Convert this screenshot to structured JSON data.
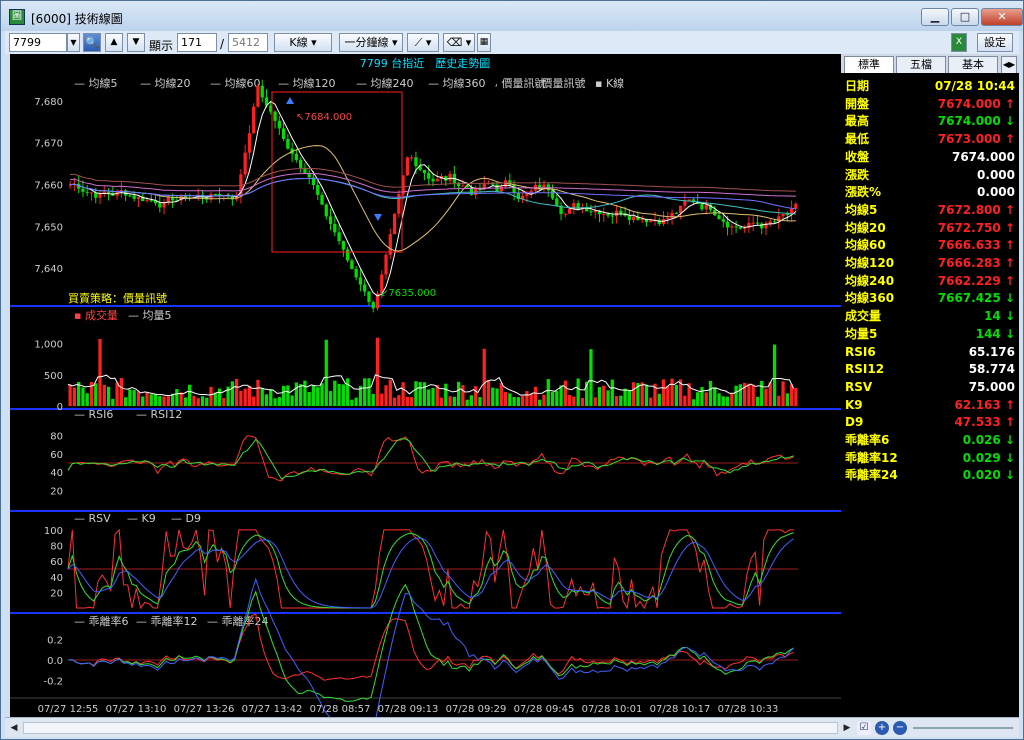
{
  "window": {
    "title": "[6000] 技術線圖",
    "app_icon": "chart-app-icon"
  },
  "toolbar": {
    "symbol": "7799",
    "display_label": "顯示",
    "display_count": "171",
    "separator": "/",
    "total_count": "5412",
    "kline_label": "K線",
    "period_label": "一分鐘線",
    "settings_label": "設定"
  },
  "chart": {
    "header": "7799 台指近　歷史走勢圖",
    "legend_main": [
      "均線5",
      "均線20",
      "均線60",
      "均線120",
      "均線240",
      "均線360",
      "價量訊號",
      "價量訊號",
      "K線"
    ],
    "high_marker": "7684.000",
    "low_marker": "7635.000",
    "strategy_label": "買賣策略：價量訊號",
    "price_ticks": [
      "7,680",
      "7,670",
      "7,660",
      "7,650",
      "7,640"
    ],
    "volume_legend": [
      "成交量",
      "均量5"
    ],
    "volume_ticks": [
      "1,000",
      "500",
      "0"
    ],
    "rsi_legend": [
      "RSI6",
      "RSI12"
    ],
    "rsi_ticks": [
      "80",
      "60",
      "40",
      "20"
    ],
    "kd_legend": [
      "RSV",
      "K9",
      "D9"
    ],
    "kd_ticks": [
      "100",
      "80",
      "60",
      "40",
      "20"
    ],
    "bias_legend": [
      "乖離率6",
      "乖離率12",
      "乖離率24"
    ],
    "bias_ticks": [
      "0.2",
      "0.0",
      "-0.2"
    ],
    "time_ticks": [
      "07/27 12:55",
      "07/27 13:10",
      "07/27 13:26",
      "07/27 13:42",
      "07/28 08:57",
      "07/28 09:13",
      "07/28 09:29",
      "07/28 09:45",
      "07/28 10:01",
      "07/28 10:17",
      "07/28 10:33"
    ],
    "colors": {
      "up": "#ff2020",
      "down": "#00e000",
      "ma": "#ffffff",
      "axis": "#1a34ff"
    }
  },
  "sidebar": {
    "tabs": [
      "標準",
      "五檔",
      "基本"
    ],
    "rows": [
      {
        "label": "日期",
        "value": "07/28 10:44",
        "arrow": "",
        "color": "#ffff00"
      },
      {
        "label": "開盤",
        "value": "7674.000",
        "arrow": "↑",
        "color": "#ff2020"
      },
      {
        "label": "最高",
        "value": "7674.000",
        "arrow": "↓",
        "color": "#00e000"
      },
      {
        "label": "最低",
        "value": "7673.000",
        "arrow": "↑",
        "color": "#ff2020"
      },
      {
        "label": "收盤",
        "value": "7674.000",
        "arrow": "",
        "color": "#ffffff"
      },
      {
        "label": "漲跌",
        "value": "0.000",
        "arrow": "",
        "color": "#ffffff"
      },
      {
        "label": "漲跌%",
        "value": "0.000",
        "arrow": "",
        "color": "#ffffff"
      },
      {
        "label": "均線5",
        "value": "7672.800",
        "arrow": "↑",
        "color": "#ff2020"
      },
      {
        "label": "均線20",
        "value": "7672.750",
        "arrow": "↑",
        "color": "#ff2020"
      },
      {
        "label": "均線60",
        "value": "7666.633",
        "arrow": "↑",
        "color": "#ff2020"
      },
      {
        "label": "均線120",
        "value": "7666.283",
        "arrow": "↑",
        "color": "#ff2020"
      },
      {
        "label": "均線240",
        "value": "7662.229",
        "arrow": "↑",
        "color": "#ff2020"
      },
      {
        "label": "均線360",
        "value": "7667.425",
        "arrow": "↓",
        "color": "#00e000"
      },
      {
        "label": "成交量",
        "value": "14",
        "arrow": "↓",
        "color": "#00e000"
      },
      {
        "label": "均量5",
        "value": "144",
        "arrow": "↓",
        "color": "#00e000"
      },
      {
        "label": "RSI6",
        "value": "65.176",
        "arrow": "",
        "color": "#ffffff"
      },
      {
        "label": "RSI12",
        "value": "58.774",
        "arrow": "",
        "color": "#ffffff"
      },
      {
        "label": "RSV",
        "value": "75.000",
        "arrow": "",
        "color": "#ffffff"
      },
      {
        "label": "K9",
        "value": "62.163",
        "arrow": "↑",
        "color": "#ff2020"
      },
      {
        "label": "D9",
        "value": "47.533",
        "arrow": "↑",
        "color": "#ff2020"
      },
      {
        "label": "乖離率6",
        "value": "0.026",
        "arrow": "↓",
        "color": "#00e000"
      },
      {
        "label": "乖離率12",
        "value": "0.029",
        "arrow": "↓",
        "color": "#00e000"
      },
      {
        "label": "乖離率24",
        "value": "0.020",
        "arrow": "↓",
        "color": "#00e000"
      }
    ]
  }
}
